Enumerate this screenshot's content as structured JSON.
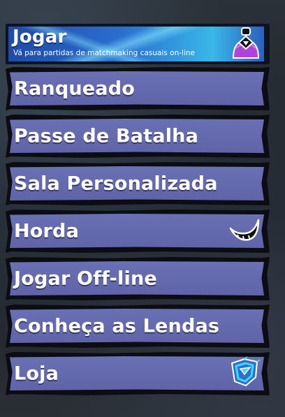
{
  "menu": {
    "featured": {
      "title": "Jogar",
      "subtitle": "Vá para partidas de matchmaking casuais on-line",
      "icon": "player-silhouette-icon"
    },
    "items": [
      {
        "label": "Ranqueado"
      },
      {
        "label": "Passe de Batalha"
      },
      {
        "label": "Sala Personalizada"
      },
      {
        "label": "Horda",
        "icon": "horns-icon"
      },
      {
        "label": "Jogar Off-line"
      },
      {
        "label": "Conheça as Lendas"
      },
      {
        "label": "Loja",
        "icon": "shop-ticket-icon"
      }
    ]
  },
  "colors": {
    "button_face": "#6a70b4",
    "featured_blue": "#2a6fd0",
    "featured_cyan": "#39b7e8",
    "frame": "#0b0d12",
    "icon_purple": "#b043d9",
    "icon_cyan": "#3fd8ff"
  }
}
